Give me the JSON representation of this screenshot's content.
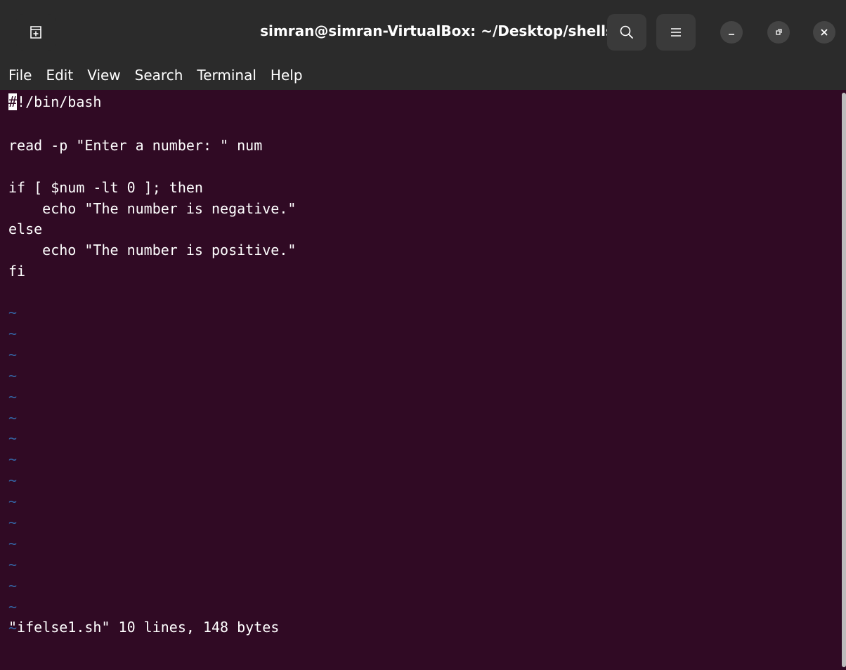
{
  "window": {
    "title": "simran@simran-VirtualBox: ~/Desktop/shells"
  },
  "titlebar": {
    "newtab_icon": "new-tab-icon",
    "search_icon": "search-icon",
    "menu_icon": "hamburger-menu-icon",
    "minimize_icon": "minimize-icon",
    "maximize_icon": "maximize-icon",
    "close_icon": "close-icon"
  },
  "menubar": {
    "items": [
      "File",
      "Edit",
      "View",
      "Search",
      "Terminal",
      "Help"
    ]
  },
  "editor": {
    "cursor_char": "#",
    "first_line_rest": "!/bin/bash",
    "lines": [
      "",
      "read -p \"Enter a number: \" num",
      "",
      "if [ $num -lt 0 ]; then",
      "    echo \"The number is negative.\"",
      "else",
      "    echo \"The number is positive.\"",
      "fi",
      ""
    ],
    "tilde": "~",
    "tilde_count": 16,
    "status": "\"ifelse1.sh\" 10 lines, 148 bytes"
  },
  "colors": {
    "background": "#300a24",
    "chrome": "#2b2b2b",
    "tilde": "#3465a4",
    "text": "#ffffff"
  }
}
